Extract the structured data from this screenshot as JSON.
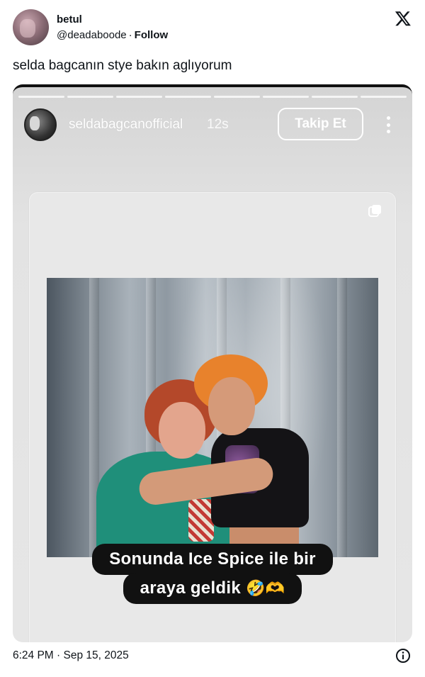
{
  "tweet": {
    "author_name": "betul",
    "author_handle": "@deadaboode",
    "separator": "·",
    "follow_label": "Follow",
    "text": "selda bagcanın stye bakın aglıyorum",
    "timestamp": "6:24 PM · Sep 15, 2025",
    "platform_icon": "x-logo-icon",
    "info_icon": "info-icon"
  },
  "story": {
    "username": "seldabagcanofficial",
    "time": "12s",
    "follow_button": "Takip Et",
    "more_icon": "more-vertical-icon",
    "progress_segments": 8,
    "caption_line1": "Sonunda Ice Spice ile bir",
    "caption_line2": "araya geldik",
    "caption_emoji": "🤣🫶",
    "card_icon": "copy-icon"
  },
  "colors": {
    "text": "#0f1419",
    "story_background": "#e3e3e3",
    "caption_background": "#111111",
    "caption_text": "#ffffff"
  }
}
